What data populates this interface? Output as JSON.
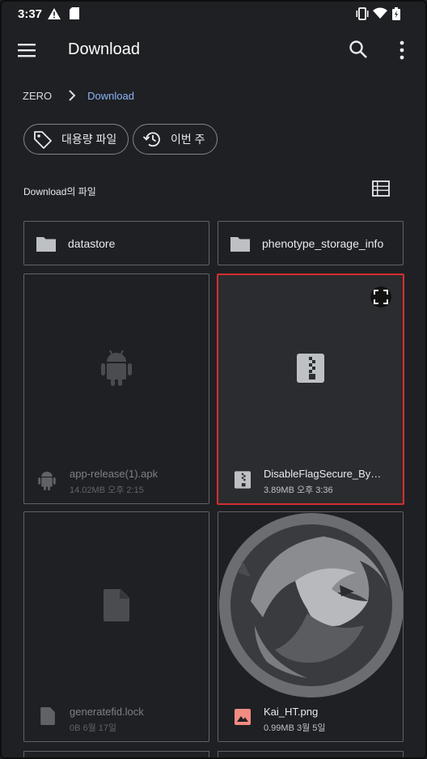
{
  "status_bar": {
    "time": "3:37"
  },
  "app_bar": {
    "title": "Download"
  },
  "breadcrumb": {
    "root": "ZERO",
    "current": "Download"
  },
  "chips": [
    {
      "label": "대용량 파일",
      "icon": "tag-icon"
    },
    {
      "label": "이번 주",
      "icon": "history-icon"
    }
  ],
  "section": {
    "title": "Download의 파일"
  },
  "folders": [
    {
      "name": "datastore"
    },
    {
      "name": "phenotype_storage_info"
    }
  ],
  "files": [
    {
      "name": "app-release(1).apk",
      "meta": "14.02MB 오후 2:15",
      "type": "android-icon"
    },
    {
      "name": "DisableFlagSecure_By_Kai_HT.zip",
      "meta": "3.89MB 오후 3:36",
      "type": "zip-icon",
      "selected": true
    },
    {
      "name": "generatefid.lock",
      "meta": "0B 6월 17일",
      "type": "file-icon"
    },
    {
      "name": "Kai_HT.png",
      "meta": "0.99MB 3월 5일",
      "type": "image-icon"
    }
  ],
  "colors": {
    "accent": "#8ab4f8",
    "selection": "#d32f2f",
    "background": "#1f2023",
    "image_icon": "#f28b82"
  }
}
